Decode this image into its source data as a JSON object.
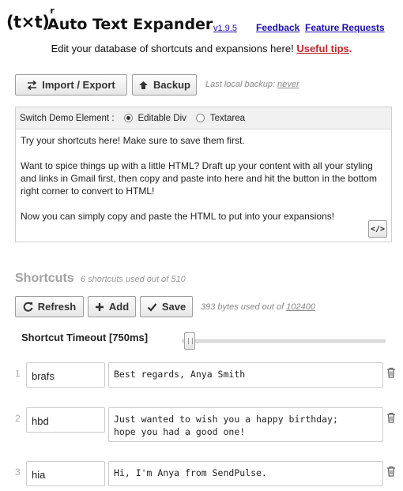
{
  "header": {
    "logo_text": "(t×t)",
    "logo_sup": "r",
    "title": "Auto Text Expander",
    "version": "v1.9.5",
    "feedback_link": "Feedback",
    "feature_link": "Feature Requests"
  },
  "subtitle": {
    "text": "Edit your database of shortcuts and expansions here! ",
    "tips_link": "Useful tips",
    "end": "."
  },
  "toolbar": {
    "import_export_label": "Import / Export",
    "backup_label": "Backup",
    "last_backup_prefix": "Last local backup: ",
    "last_backup_value": "never"
  },
  "demo": {
    "switch_label": "Switch Demo Element :",
    "option_div": "Editable Div",
    "option_textarea": "Textarea",
    "selected": "Editable Div",
    "paragraphs": [
      "Try your shortcuts here! Make sure to save them first.",
      "Want to spice things up with a little HTML? Draft up your content with all your styling and links in Gmail first, then copy and paste into here and hit the button in the bottom right corner to convert to HTML!",
      "Now you can simply copy and paste the HTML to put into your expansions!"
    ],
    "html_button_label": "</>"
  },
  "shortcuts": {
    "title": "Shortcuts",
    "count_text": "6 shortcuts used out of 510",
    "refresh_label": "Refresh",
    "add_label": "Add",
    "save_label": "Save",
    "bytes_prefix": "393 bytes used out of ",
    "bytes_limit": "102400",
    "timeout_label": "Shortcut Timeout [750ms]",
    "timeout_ms": 750,
    "rows": [
      {
        "num": "1",
        "shortcut": "brafs",
        "expansion": "Best regards, Anya Smith"
      },
      {
        "num": "2",
        "shortcut": "hbd",
        "expansion": "Just wanted to wish you a happy birthday;\nhope you had a good one!"
      },
      {
        "num": "3",
        "shortcut": "hia",
        "expansion": "Hi, I'm Anya from SendPulse."
      }
    ]
  },
  "icons": {
    "import_export": "swap-arrows-icon",
    "backup": "upload-icon",
    "refresh": "refresh-icon",
    "add": "plus-icon",
    "save": "checkmark-icon",
    "delete": "trash-icon"
  }
}
